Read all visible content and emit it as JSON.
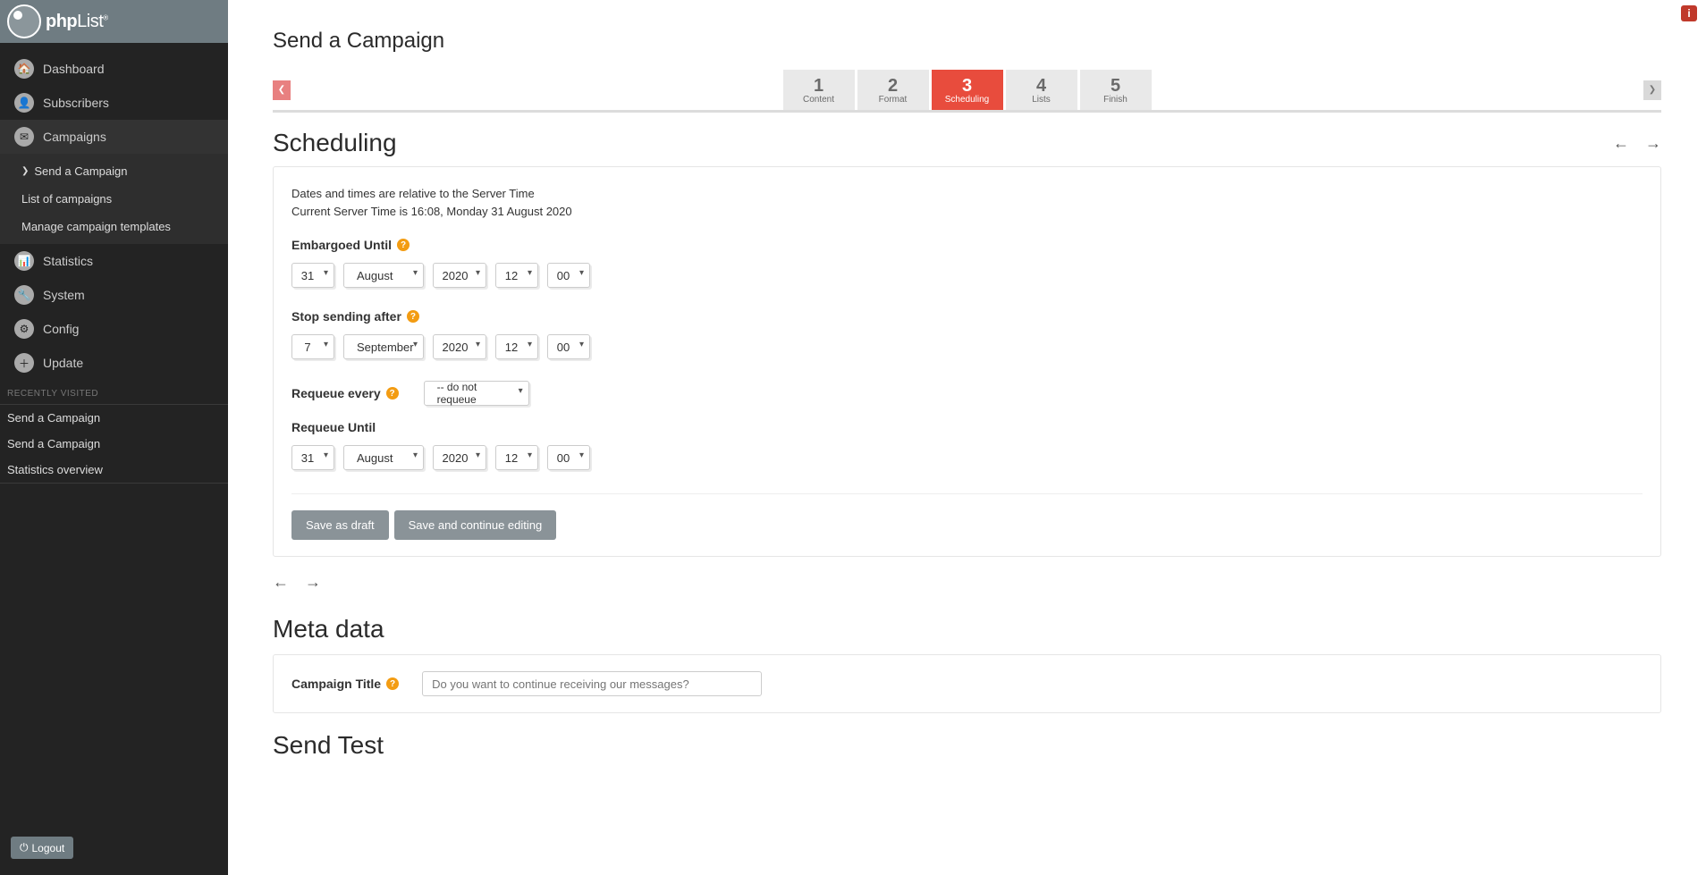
{
  "brand": {
    "name": "phpList"
  },
  "sidebar": {
    "items": [
      {
        "label": "Dashboard",
        "icon": "🏠"
      },
      {
        "label": "Subscribers",
        "icon": "👤"
      },
      {
        "label": "Campaigns",
        "icon": "✉"
      },
      {
        "label": "Statistics",
        "icon": "📊"
      },
      {
        "label": "System",
        "icon": "🔧"
      },
      {
        "label": "Config",
        "icon": "⚙"
      },
      {
        "label": "Update",
        "icon": "＋"
      }
    ],
    "campaigns_sub": [
      {
        "label": "Send a Campaign"
      },
      {
        "label": "List of campaigns"
      },
      {
        "label": "Manage campaign templates"
      }
    ],
    "recent_header": "RECENTLY VISITED",
    "recent": [
      {
        "label": "Send a Campaign"
      },
      {
        "label": "Send a Campaign"
      },
      {
        "label": "Statistics overview"
      }
    ],
    "logout": "Logout"
  },
  "page": {
    "title": "Send a Campaign",
    "steps": [
      {
        "num": "1",
        "label": "Content"
      },
      {
        "num": "2",
        "label": "Format"
      },
      {
        "num": "3",
        "label": "Scheduling"
      },
      {
        "num": "4",
        "label": "Lists"
      },
      {
        "num": "5",
        "label": "Finish"
      }
    ],
    "active_step": 3
  },
  "scheduling": {
    "heading": "Scheduling",
    "info_line1": "Dates and times are relative to the Server Time",
    "info_line2": "Current Server Time is 16:08, Monday 31 August 2020",
    "embargoed_label": "Embargoed Until",
    "embargoed": {
      "day": "31",
      "month": "August",
      "year": "2020",
      "hour": "12",
      "minute": "00"
    },
    "stop_label": "Stop sending after",
    "stop": {
      "day": "7",
      "month": "September",
      "year": "2020",
      "hour": "12",
      "minute": "00"
    },
    "requeue_every_label": "Requeue every",
    "requeue_every_value": "-- do not requeue",
    "requeue_until_label": "Requeue Until",
    "requeue_until": {
      "day": "31",
      "month": "August",
      "year": "2020",
      "hour": "12",
      "minute": "00"
    },
    "save_draft": "Save as draft",
    "save_continue": "Save and continue editing"
  },
  "meta": {
    "heading": "Meta data",
    "campaign_title_label": "Campaign Title",
    "placeholder": "Do you want to continue receiving our messages?"
  },
  "send_test": {
    "heading": "Send Test"
  }
}
